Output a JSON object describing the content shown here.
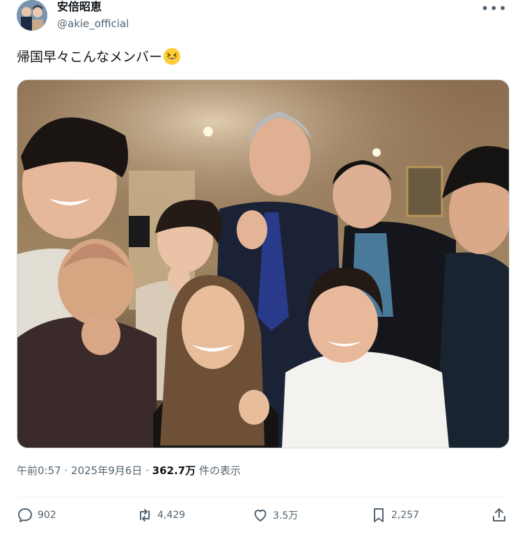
{
  "author": {
    "display_name": "安倍昭恵",
    "handle": "@akie_official"
  },
  "menu_icon": "more-horizontal-icon",
  "post": {
    "text": "帰国早々こんなメンバー",
    "emoji": "grinning-squinting-face"
  },
  "meta": {
    "time": "午前0:57",
    "sep1": "·",
    "date": "2025年9月6日",
    "sep2": "·",
    "views_count": "362.7万",
    "views_label": "件の表示"
  },
  "actions": {
    "reply_count": "902",
    "repost_count": "4,429",
    "like_count": "3.5万",
    "bookmark_count": "2,257"
  },
  "colors": {
    "text": "#0f1419",
    "secondary": "#536471",
    "divider": "#eff3f4"
  }
}
